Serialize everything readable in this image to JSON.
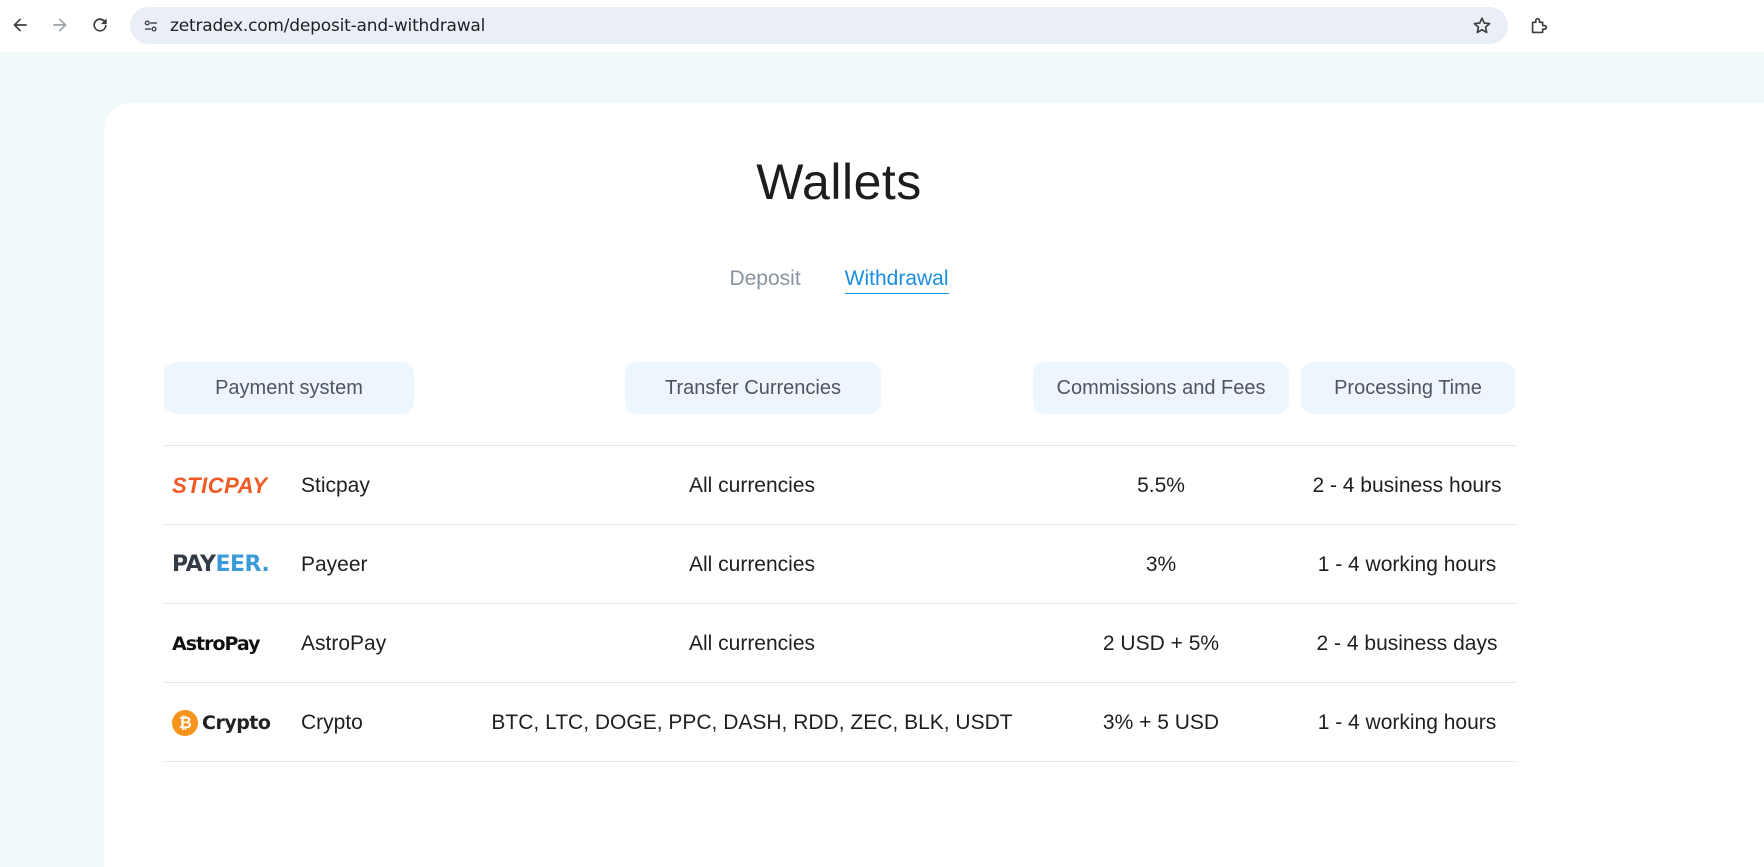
{
  "browser": {
    "url": "zetradex.com/deposit-and-withdrawal",
    "icons": [
      "back-icon",
      "forward-icon",
      "reload-icon",
      "site-info-icon",
      "bookmark-star-icon",
      "extensions-icon"
    ]
  },
  "page": {
    "title": "Wallets",
    "tabs": [
      {
        "label": "Deposit",
        "active": false
      },
      {
        "label": "Withdrawal",
        "active": true
      }
    ],
    "table": {
      "headers": [
        "Payment system",
        "Transfer Currencies",
        "Commissions and Fees",
        "Processing Time"
      ],
      "rows": [
        {
          "logo": "STICPAY",
          "name": "Sticpay",
          "currencies": "All currencies",
          "fees": "5.5%",
          "time": "2 - 4 business hours"
        },
        {
          "logo_part1": "PAY",
          "logo_part2": "EER.",
          "name": "Payeer",
          "currencies": "All currencies",
          "fees": "3%",
          "time": "1 - 4 working hours"
        },
        {
          "logo": "AstroPay",
          "name": "AstroPay",
          "currencies": "All currencies",
          "fees": "2 USD + 5%",
          "time": "2 - 4 business days"
        },
        {
          "logo_symbol": "₿",
          "logo": "Crypto",
          "name": "Crypto",
          "currencies": "BTC, LTC, DOGE, PPC, DASH, RDD, ZEC, BLK, USDT",
          "fees": "3% + 5 USD",
          "time": "1 - 4 working hours"
        }
      ]
    }
  },
  "colors": {
    "accent": "#1a8ee0",
    "sticpay": "#f05a24",
    "payeer_blue": "#3a9bd8",
    "bitcoin": "#f7931a",
    "header_bg": "#edf5fd"
  }
}
